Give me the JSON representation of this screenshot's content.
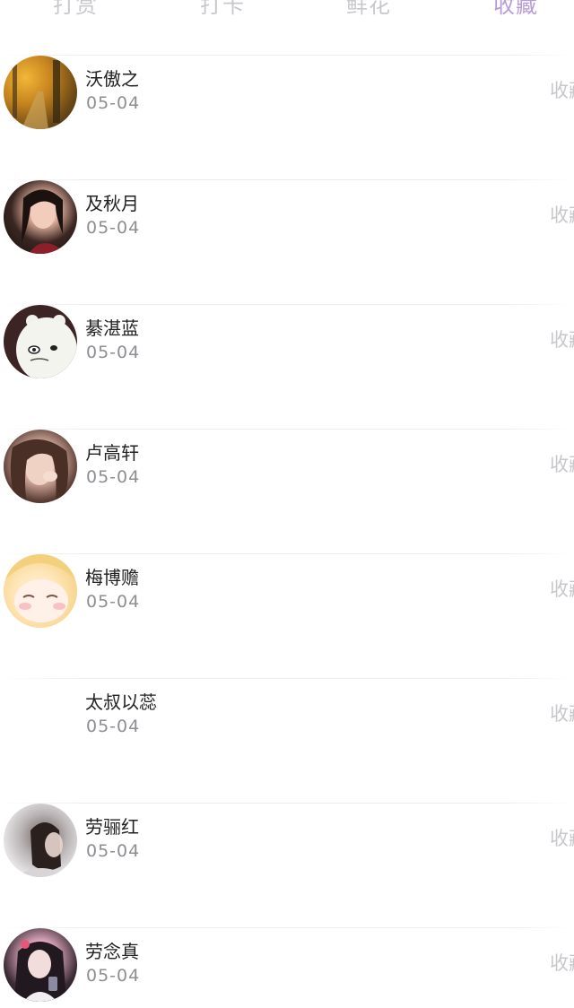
{
  "tabs": [
    {
      "label": "打赏",
      "active": false
    },
    {
      "label": "打卡",
      "active": false
    },
    {
      "label": "鲜花",
      "active": false
    },
    {
      "label": "收藏",
      "active": true
    }
  ],
  "colors": {
    "active_tab": "#b79ad8",
    "inactive_tab": "#c8c8cc",
    "name": "#222222",
    "date": "#8e8e93"
  },
  "list": [
    {
      "name": "沃傲之",
      "date": "05-04",
      "action": "收藏",
      "avatar": "autumn-forest-photo"
    },
    {
      "name": "及秋月",
      "date": "05-04",
      "action": "收藏",
      "avatar": "girl-portrait-photo"
    },
    {
      "name": "綦湛蓝",
      "date": "05-04",
      "action": "收藏",
      "avatar": "white-bear-cartoon"
    },
    {
      "name": "卢高轩",
      "date": "05-04",
      "action": "收藏",
      "avatar": "girl-portrait-photo"
    },
    {
      "name": "梅博赡",
      "date": "05-04",
      "action": "收藏",
      "avatar": "anime-girl-illustration"
    },
    {
      "name": "太叔以蕊",
      "date": "05-04",
      "action": "收藏",
      "avatar": "none"
    },
    {
      "name": "劳骊红",
      "date": "05-04",
      "action": "收藏",
      "avatar": "girl-portrait-photo"
    },
    {
      "name": "劳念真",
      "date": "05-04",
      "action": "收藏",
      "avatar": "girl-portrait-photo"
    }
  ]
}
